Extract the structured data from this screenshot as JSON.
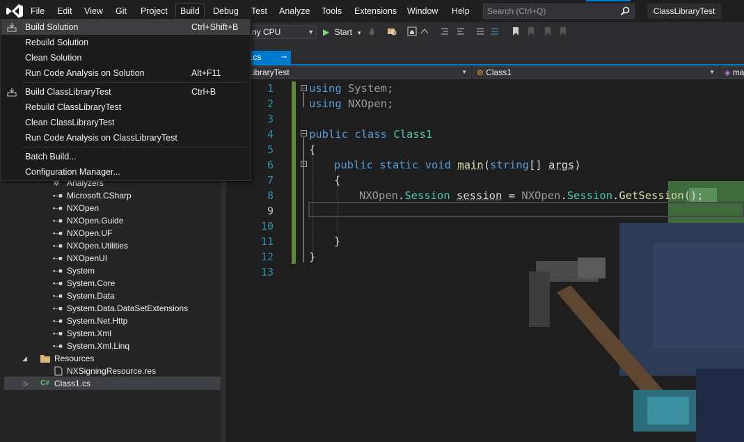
{
  "menubar": {
    "items": [
      "File",
      "Edit",
      "View",
      "Git",
      "Project",
      "Build",
      "Debug",
      "Test",
      "Analyze",
      "Tools",
      "Extensions",
      "Window",
      "Help"
    ],
    "search_placeholder": "Search (Ctrl+Q)",
    "solution_name": "ClassLibraryTest"
  },
  "toolbar": {
    "platform": "ny CPU",
    "start_label": "Start"
  },
  "doc_tabs": {
    "active": ".cs"
  },
  "navbar": {
    "project": "ssLibraryTest",
    "class": "Class1",
    "member": "ma"
  },
  "build_menu": {
    "items": [
      {
        "label": "Build Solution",
        "shortcut": "Ctrl+Shift+B",
        "icon": "build-icon"
      },
      {
        "label": "Rebuild Solution",
        "shortcut": ""
      },
      {
        "label": "Clean Solution",
        "shortcut": ""
      },
      {
        "label": "Run Code Analysis on Solution",
        "shortcut": "Alt+F11"
      },
      {
        "label": "Build ClassLibraryTest",
        "shortcut": "Ctrl+B",
        "icon": "build-icon"
      },
      {
        "label": "Rebuild ClassLibraryTest",
        "shortcut": ""
      },
      {
        "label": "Clean ClassLibraryTest",
        "shortcut": ""
      },
      {
        "label": "Run Code Analysis on ClassLibraryTest",
        "shortcut": ""
      },
      {
        "label": "Batch Build...",
        "shortcut": ""
      },
      {
        "label": "Configuration Manager...",
        "shortcut": ""
      }
    ]
  },
  "explorer": {
    "analyzers": "Analyzers",
    "references": [
      "Microsoft.CSharp",
      "NXOpen",
      "NXOpen.Guide",
      "NXOpen.UF",
      "NXOpen.Utilities",
      "NXOpenUI",
      "System",
      "System.Core",
      "System.Data",
      "System.Data.DataSetExtensions",
      "System.Net.Http",
      "System.Xml",
      "System.Xml.Linq"
    ],
    "resources_folder": "Resources",
    "resource_file": "NXSigningResource.res",
    "class_file": "Class1.cs"
  },
  "editor": {
    "line_numbers": [
      "1",
      "2",
      "3",
      "4",
      "5",
      "6",
      "7",
      "8",
      "9",
      "10",
      "11",
      "12",
      "13"
    ],
    "tokens": {
      "using": "using",
      "system": "System;",
      "nxopen": "NXOpen;",
      "public": "public",
      "class": "class",
      "class1": "Class1",
      "open_brace": "{",
      "close_brace": "}",
      "static": "static",
      "void": "void",
      "main": "main",
      "paren_open": "(",
      "string": "string",
      "brackets": "[]",
      "args": "args",
      "paren_close": ")",
      "nxopen_ns": "NXOpen",
      "dot": ".",
      "session_type": "Session",
      "session_var": "session",
      "equals": "=",
      "get_session": "GetSession",
      "call_end": "();"
    }
  },
  "colors": {
    "accent": "#007acc",
    "keyword": "#569cd6",
    "type": "#4ec9b0",
    "method": "#dcdcaa",
    "line_number": "#2b91af",
    "change_bar": "#5c8a34"
  }
}
